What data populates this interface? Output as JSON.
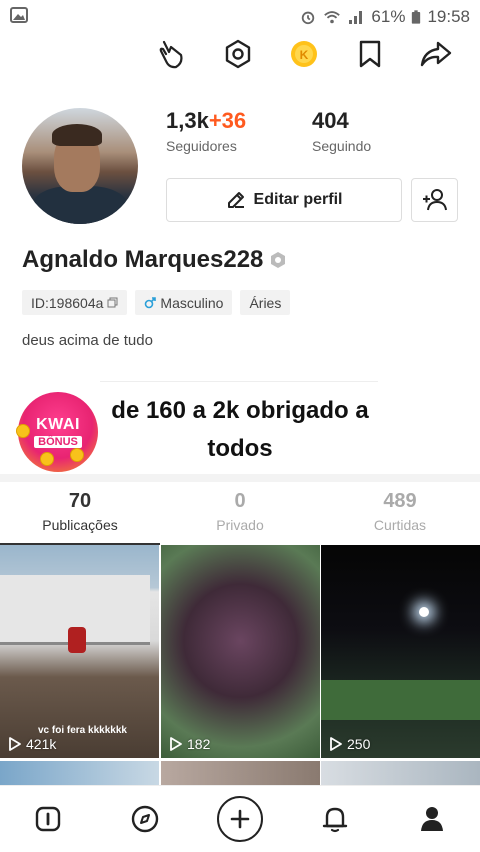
{
  "status": {
    "time": "19:58",
    "battery": "61%"
  },
  "profile": {
    "followers": "1,3k",
    "followers_delta": "+36",
    "followers_label": "Seguidores",
    "following": "404",
    "following_label": "Seguindo",
    "edit_label": "Editar perfil",
    "name": "Agnaldo Marques228",
    "id_tag": "ID:198604a",
    "gender_tag": "Masculino",
    "sign_tag": "Áries",
    "bio": "deus acima de tudo"
  },
  "promo": {
    "badge_top": "KWAI",
    "badge_bottom": "BÔNUS",
    "text": "de 160 a 2k obrigado a todos"
  },
  "tabs": [
    {
      "count": "70",
      "label": "Publicações"
    },
    {
      "count": "0",
      "label": "Privado"
    },
    {
      "count": "489",
      "label": "Curtidas"
    }
  ],
  "videos": [
    {
      "views": "421k",
      "caption": "vc foi fera kkkkkkk"
    },
    {
      "views": "182",
      "caption": ""
    },
    {
      "views": "250",
      "caption": ""
    }
  ],
  "colors": {
    "accent": "#ff5a1f",
    "promo_badge": "#e82472"
  },
  "icons": [
    "hand-icon",
    "settings-icon",
    "kwai-coin-icon",
    "bookmark-icon",
    "share-icon",
    "pencil-icon",
    "add-friend-icon",
    "verified-icon",
    "home-icon",
    "discover-icon",
    "plus-icon",
    "bell-icon",
    "profile-icon"
  ]
}
